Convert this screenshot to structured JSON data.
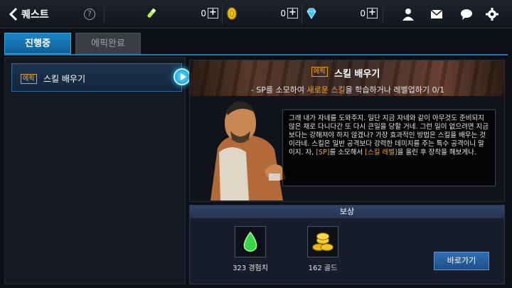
{
  "header": {
    "title": "퀘스트",
    "help_label": "?",
    "currencies": [
      {
        "name": "potion",
        "value": "0"
      },
      {
        "name": "gold-coin",
        "value": "0"
      },
      {
        "name": "diamond",
        "value": "0"
      }
    ],
    "plus_label": "+"
  },
  "tabs": [
    {
      "label": "진행중",
      "active": true
    },
    {
      "label": "에픽완료",
      "active": false
    }
  ],
  "quest_list": [
    {
      "badge": "에픽",
      "name": "스킬 배우기"
    }
  ],
  "detail": {
    "badge": "에픽",
    "title": "스킬 배우기",
    "objective_prefix": "- SP를 소모하여 ",
    "objective_highlight": "새로운 스킬",
    "objective_suffix": "을 학습하거나 레벨업하기 0/1",
    "dialog_part1": "그래 내가 자네를 도와주지. 일단 지금 자네와 같이 아무것도 준비되지 않은 채로 다니다간 또 다시 큰일을 당할 거네. 그런 일이 없으려면 지금보다는 강해져야 하지 않겠나? 가장 효과적인 방법은 스킬을 배우는 것이라네. 스킬은 일반 공격보다 강력한 데미지를 주는 특수 공격이니 말이지. 자, ",
    "dialog_hl1": "[SP]",
    "dialog_part2": "를 소모해서 ",
    "dialog_hl2": "[스킬 레벨]",
    "dialog_part3": "을 올린 후 장착을 해보게나."
  },
  "reward": {
    "header": "보상",
    "items": [
      {
        "label": "323 경험치",
        "icon": "exp-potion-icon"
      },
      {
        "label": "162 골드",
        "icon": "gold-coins-icon"
      }
    ],
    "goto_label": "바로가기"
  },
  "colors": {
    "accent": "#1c86c6",
    "highlight": "#f0a43a",
    "badge": "#f0b030"
  }
}
